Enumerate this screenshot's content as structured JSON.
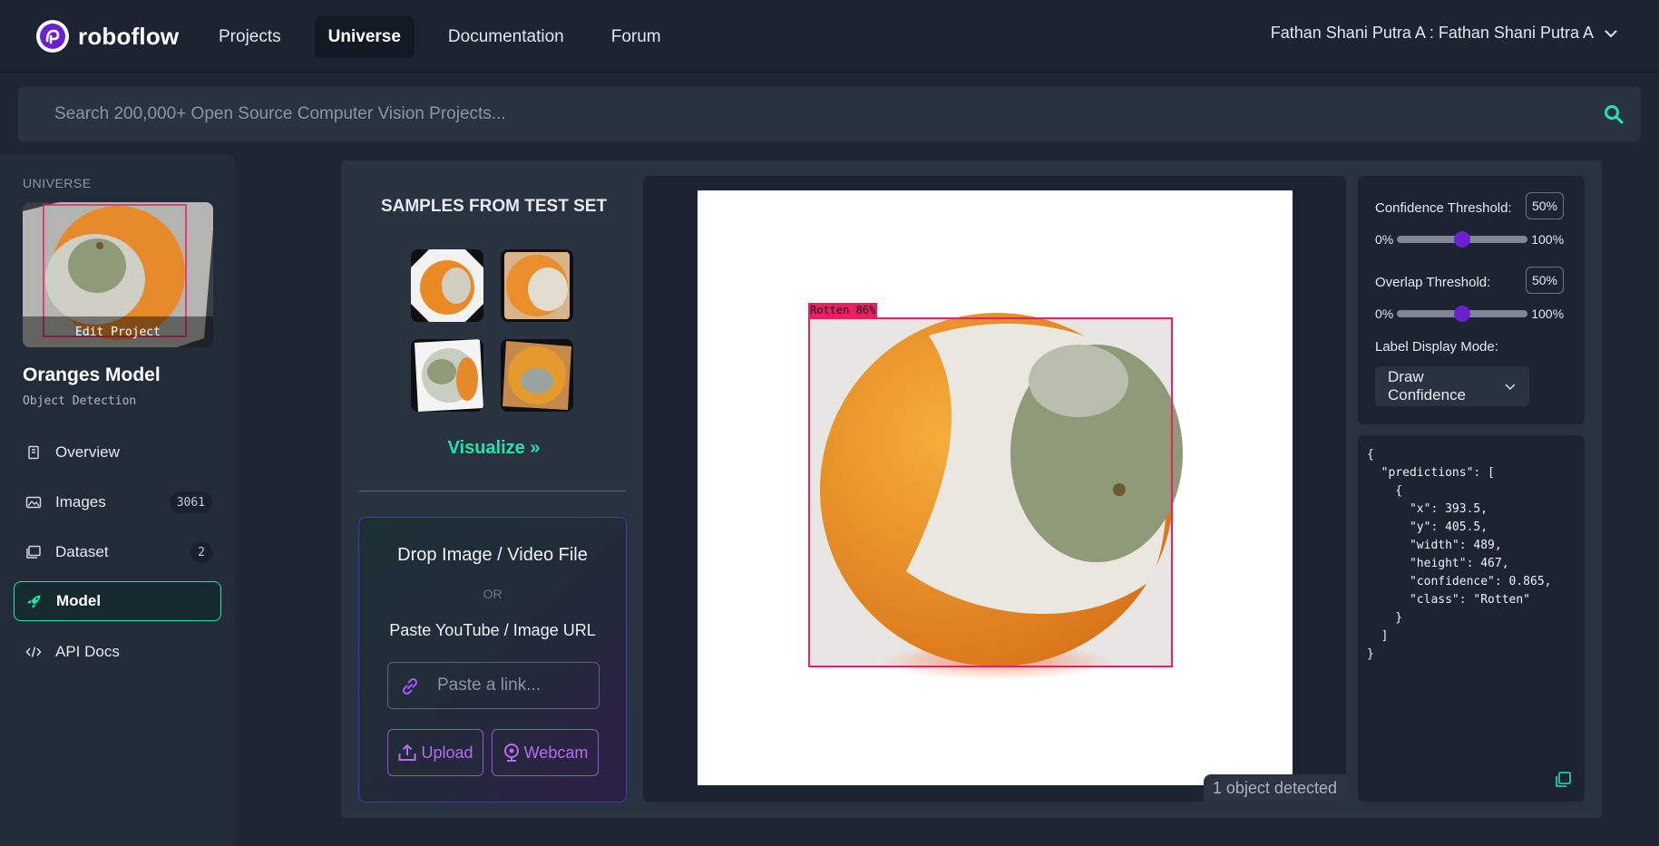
{
  "header": {
    "brand": "roboflow",
    "nav": [
      {
        "label": "Projects"
      },
      {
        "label": "Universe"
      },
      {
        "label": "Documentation"
      },
      {
        "label": "Forum"
      }
    ],
    "active_nav": "Universe",
    "user": "Fathan Shani Putra A : Fathan Shani Putra A"
  },
  "search": {
    "placeholder": "Search 200,000+ Open Source Computer Vision Projects...",
    "value": ""
  },
  "sidebar": {
    "section": "UNIVERSE",
    "edit_project": "Edit Project",
    "project_name": "Oranges Model",
    "project_type": "Object Detection",
    "items": [
      {
        "label": "Overview",
        "icon": "book-icon"
      },
      {
        "label": "Images",
        "icon": "images-icon",
        "count": "3061"
      },
      {
        "label": "Dataset",
        "icon": "dataset-icon",
        "count": "2"
      },
      {
        "label": "Model",
        "icon": "rocket-icon",
        "active": true
      },
      {
        "label": "API Docs",
        "icon": "code-icon"
      }
    ]
  },
  "samples": {
    "title": "SAMPLES FROM TEST SET",
    "visualize": "Visualize »"
  },
  "drop": {
    "title": "Drop Image / Video File",
    "or": "OR",
    "paste_label": "Paste YouTube / Image URL",
    "link_placeholder": "Paste a link...",
    "upload": "Upload",
    "webcam": "Webcam"
  },
  "result": {
    "box_label": "Rotten 86%",
    "detected": "1 object detected"
  },
  "controls": {
    "confidence_label": "Confidence Threshold:",
    "confidence_value": "50%",
    "confidence": 0.5,
    "overlap_label": "Overlap Threshold:",
    "overlap_value": "50%",
    "overlap": 0.5,
    "min": "0%",
    "max": "100%",
    "label_mode_label": "Label Display Mode:",
    "label_mode": "Draw Confidence"
  },
  "json_output": "{\n  \"predictions\": [\n    {\n      \"x\": 393.5,\n      \"y\": 405.5,\n      \"width\": 489,\n      \"height\": 467,\n      \"confidence\": 0.865,\n      \"class\": \"Rotten\"\n    }\n  ]\n}",
  "colors": {
    "accent": "#20e3b2",
    "purple": "#9d4edd",
    "box": "#ea1f64",
    "slider_knob": "#6a1fd0"
  }
}
